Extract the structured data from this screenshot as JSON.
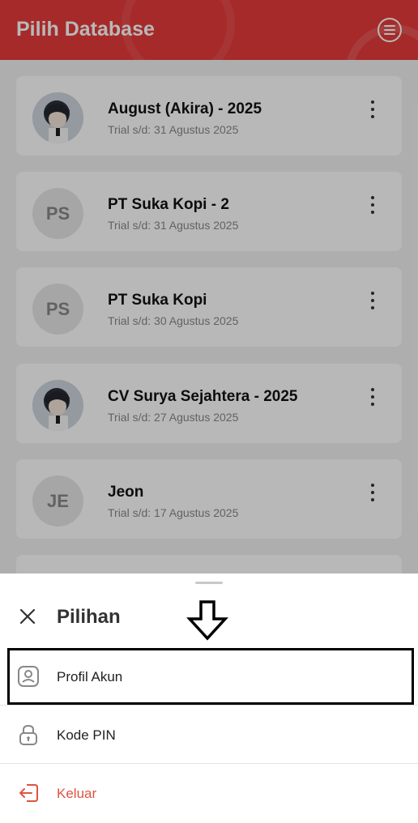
{
  "appbar": {
    "title": "Pilih Database",
    "menu_icon": "menu-circle-icon"
  },
  "databases": [
    {
      "name": "August (Akira) - 2025",
      "subtitle": "Trial s/d: 31 Agustus 2025",
      "avatar": ""
    },
    {
      "name": "PT Suka Kopi - 2",
      "subtitle": "Trial s/d: 31 Agustus 2025",
      "avatar": "PS"
    },
    {
      "name": "PT Suka Kopi",
      "subtitle": "Trial s/d: 30 Agustus 2025",
      "avatar": "PS"
    },
    {
      "name": "CV Surya Sejahtera - 2025",
      "subtitle": "Trial s/d: 27 Agustus 2025",
      "avatar": ""
    },
    {
      "name": "Jeon",
      "subtitle": "Trial s/d: 17 Agustus 2025",
      "avatar": "JE"
    }
  ],
  "sheet": {
    "title": "Pilihan",
    "options": [
      {
        "label": "Profil Akun",
        "icon": "user-profile-icon"
      },
      {
        "label": "Kode PIN",
        "icon": "lock-icon"
      },
      {
        "label": "Keluar",
        "icon": "logout-icon"
      }
    ]
  },
  "colors": {
    "primary": "#e63b3b",
    "logout": "#e0533f"
  }
}
